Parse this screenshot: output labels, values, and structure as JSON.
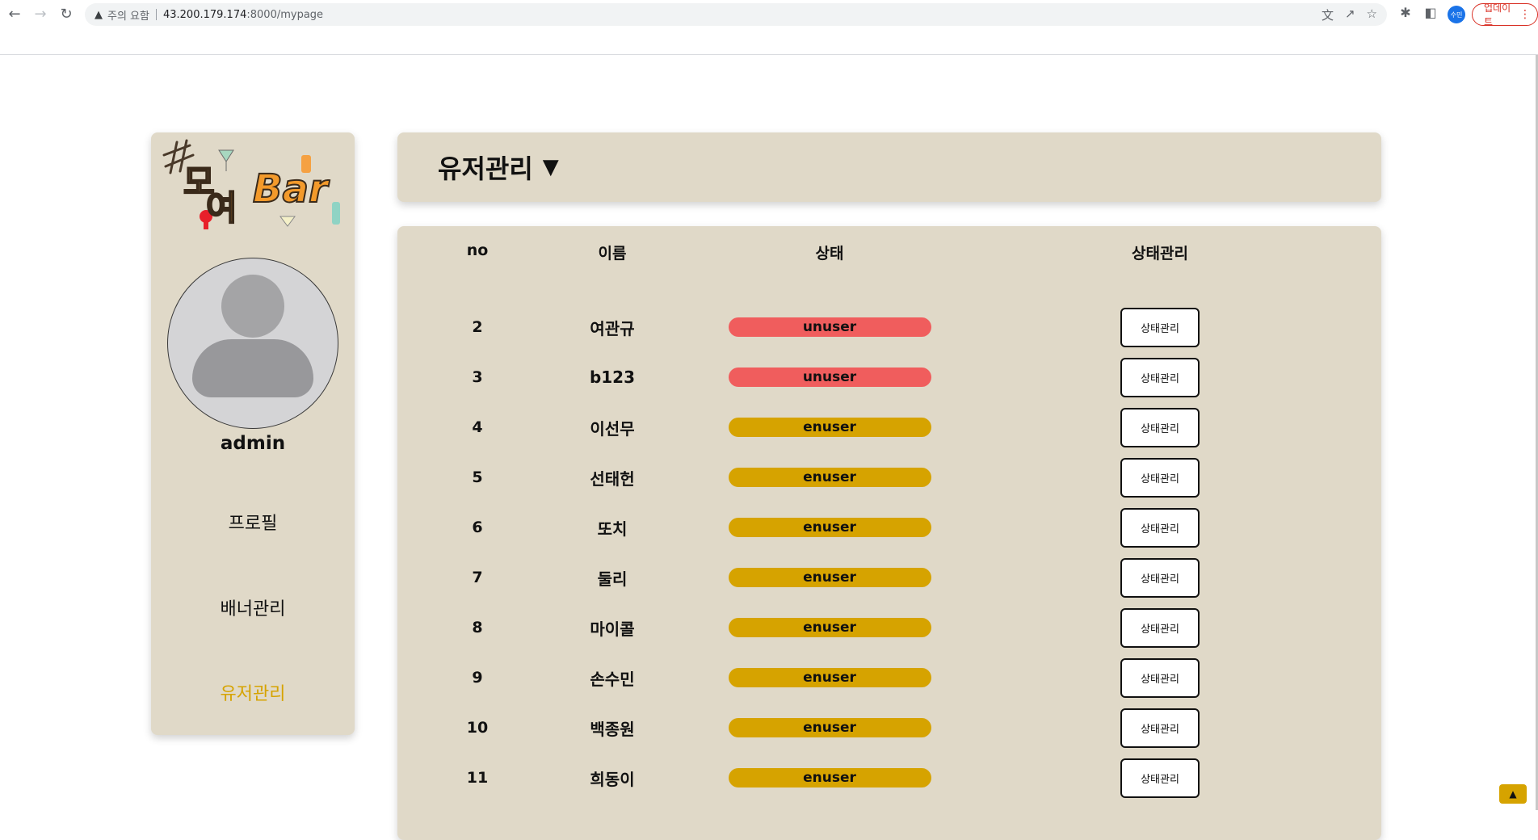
{
  "browser": {
    "security_label": "주의 요함",
    "url_host": "43.200.179.174",
    "url_path": ":8000/mypage",
    "profile_initials": "수민",
    "update_label": "업데이트"
  },
  "sidebar": {
    "logo_text": "모여Bar",
    "username": "admin",
    "menu": [
      {
        "label": "프로필"
      },
      {
        "label": "배너관리"
      },
      {
        "label": "유저관리"
      }
    ]
  },
  "header": {
    "title": "유저관리",
    "arrow": "▼"
  },
  "table": {
    "columns": {
      "no": "no",
      "name": "이름",
      "state": "상태",
      "manage": "상태관리"
    },
    "manage_label": "상태관리",
    "rows": [
      {
        "no": "2",
        "name": "여관규",
        "state": "unuser"
      },
      {
        "no": "3",
        "name": "b123",
        "state": "unuser"
      },
      {
        "no": "4",
        "name": "이선무",
        "state": "enuser"
      },
      {
        "no": "5",
        "name": "선태헌",
        "state": "enuser"
      },
      {
        "no": "6",
        "name": "또치",
        "state": "enuser"
      },
      {
        "no": "7",
        "name": "둘리",
        "state": "enuser"
      },
      {
        "no": "8",
        "name": "마이콜",
        "state": "enuser"
      },
      {
        "no": "9",
        "name": "손수민",
        "state": "enuser"
      },
      {
        "no": "10",
        "name": "백종원",
        "state": "enuser"
      },
      {
        "no": "11",
        "name": "희동이",
        "state": "enuser"
      }
    ]
  },
  "scroll_top": "▲",
  "colors": {
    "card_bg": "#e0d9c8",
    "accent": "#d6a300",
    "unuser": "#f05d5d",
    "enuser": "#d6a300"
  }
}
